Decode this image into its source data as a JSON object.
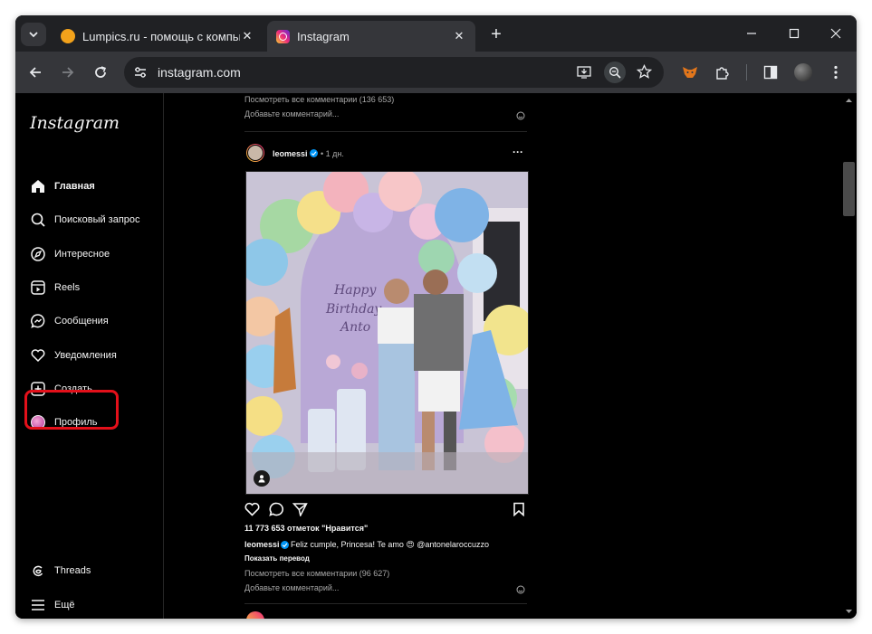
{
  "tabs": [
    {
      "title": "Lumpics.ru - помощь с компьютером",
      "close": "✕"
    },
    {
      "title": "Instagram",
      "close": "✕"
    }
  ],
  "newtab_label": "+",
  "address": {
    "url": "instagram.com"
  },
  "sidebar": {
    "logo": "Instagram",
    "items": [
      {
        "label": "Главная",
        "icon": "home-icon"
      },
      {
        "label": "Поисковый запрос",
        "icon": "search-icon"
      },
      {
        "label": "Интересное",
        "icon": "compass-icon"
      },
      {
        "label": "Reels",
        "icon": "reels-icon"
      },
      {
        "label": "Сообщения",
        "icon": "messenger-icon"
      },
      {
        "label": "Уведомления",
        "icon": "heart-icon"
      },
      {
        "label": "Создать",
        "icon": "plus-square-icon"
      },
      {
        "label": "Профиль",
        "icon": "avatar"
      }
    ],
    "bottom": [
      {
        "label": "Threads",
        "icon": "threads-icon"
      },
      {
        "label": "Ещё",
        "icon": "menu-icon"
      }
    ]
  },
  "feed": {
    "prev_post": {
      "view_comments": "Посмотреть все комментарии (136 653)",
      "add_comment": "Добавьте комментарий..."
    },
    "post": {
      "username": "leomessi",
      "time": "• 1 дн.",
      "more": "···",
      "image_text": "Happy Birthday Anto",
      "likes": "11 773 653 отметок \"Нравится\"",
      "caption_user": "leomessi",
      "caption": "Feliz cumple, Princesa! Te amo 😍 @antonelaroccuzzo",
      "translate": "Показать перевод",
      "view_comments": "Посмотреть все комментарии (96 627)",
      "add_comment": "Добавьте комментарий..."
    }
  },
  "colors": {
    "highlight": "#e3101a",
    "verified": "#0095f6"
  }
}
